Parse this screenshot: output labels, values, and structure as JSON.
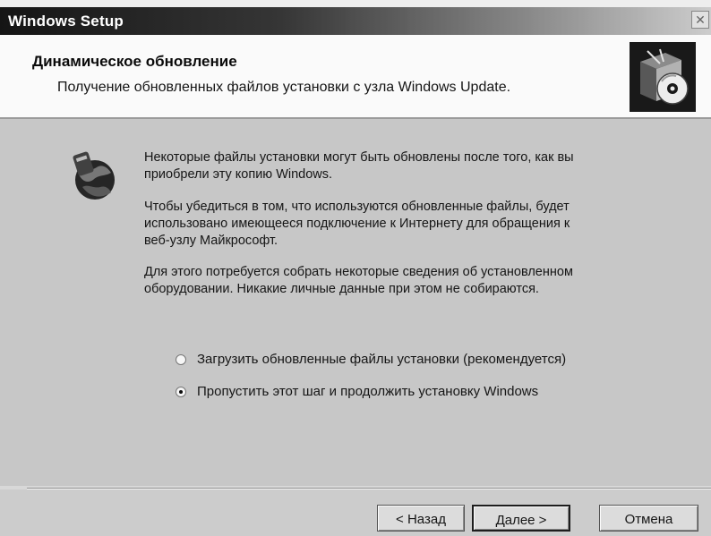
{
  "window": {
    "title": "Windows Setup",
    "close_glyph": "✕"
  },
  "header": {
    "title": "Динамическое обновление",
    "subtitle": "Получение обновленных файлов установки с узла Windows Update."
  },
  "content": {
    "paragraphs": [
      "Некоторые файлы установки могут быть обновлены после того, как вы приобрели эту копию Windows.",
      "Чтобы убедиться в том, что используются обновленные файлы, будет использовано имеющееся подключение к Интернету для обращения к веб-узлу Майкрософт.",
      "Для этого потребуется собрать некоторые сведения об установленном оборудовании. Никакие личные данные при этом не собираются."
    ],
    "options": [
      {
        "label": "Загрузить обновленные файлы установки (рекомендуется)",
        "selected": false
      },
      {
        "label": "Пропустить этот шаг и продолжить установку Windows",
        "selected": true
      }
    ]
  },
  "footer": {
    "back_label": "< Назад",
    "next_label": "Далее >",
    "cancel_label": "Отмена"
  },
  "icons": {
    "header": "setup-box-cd-icon",
    "side": "globe-update-icon"
  }
}
